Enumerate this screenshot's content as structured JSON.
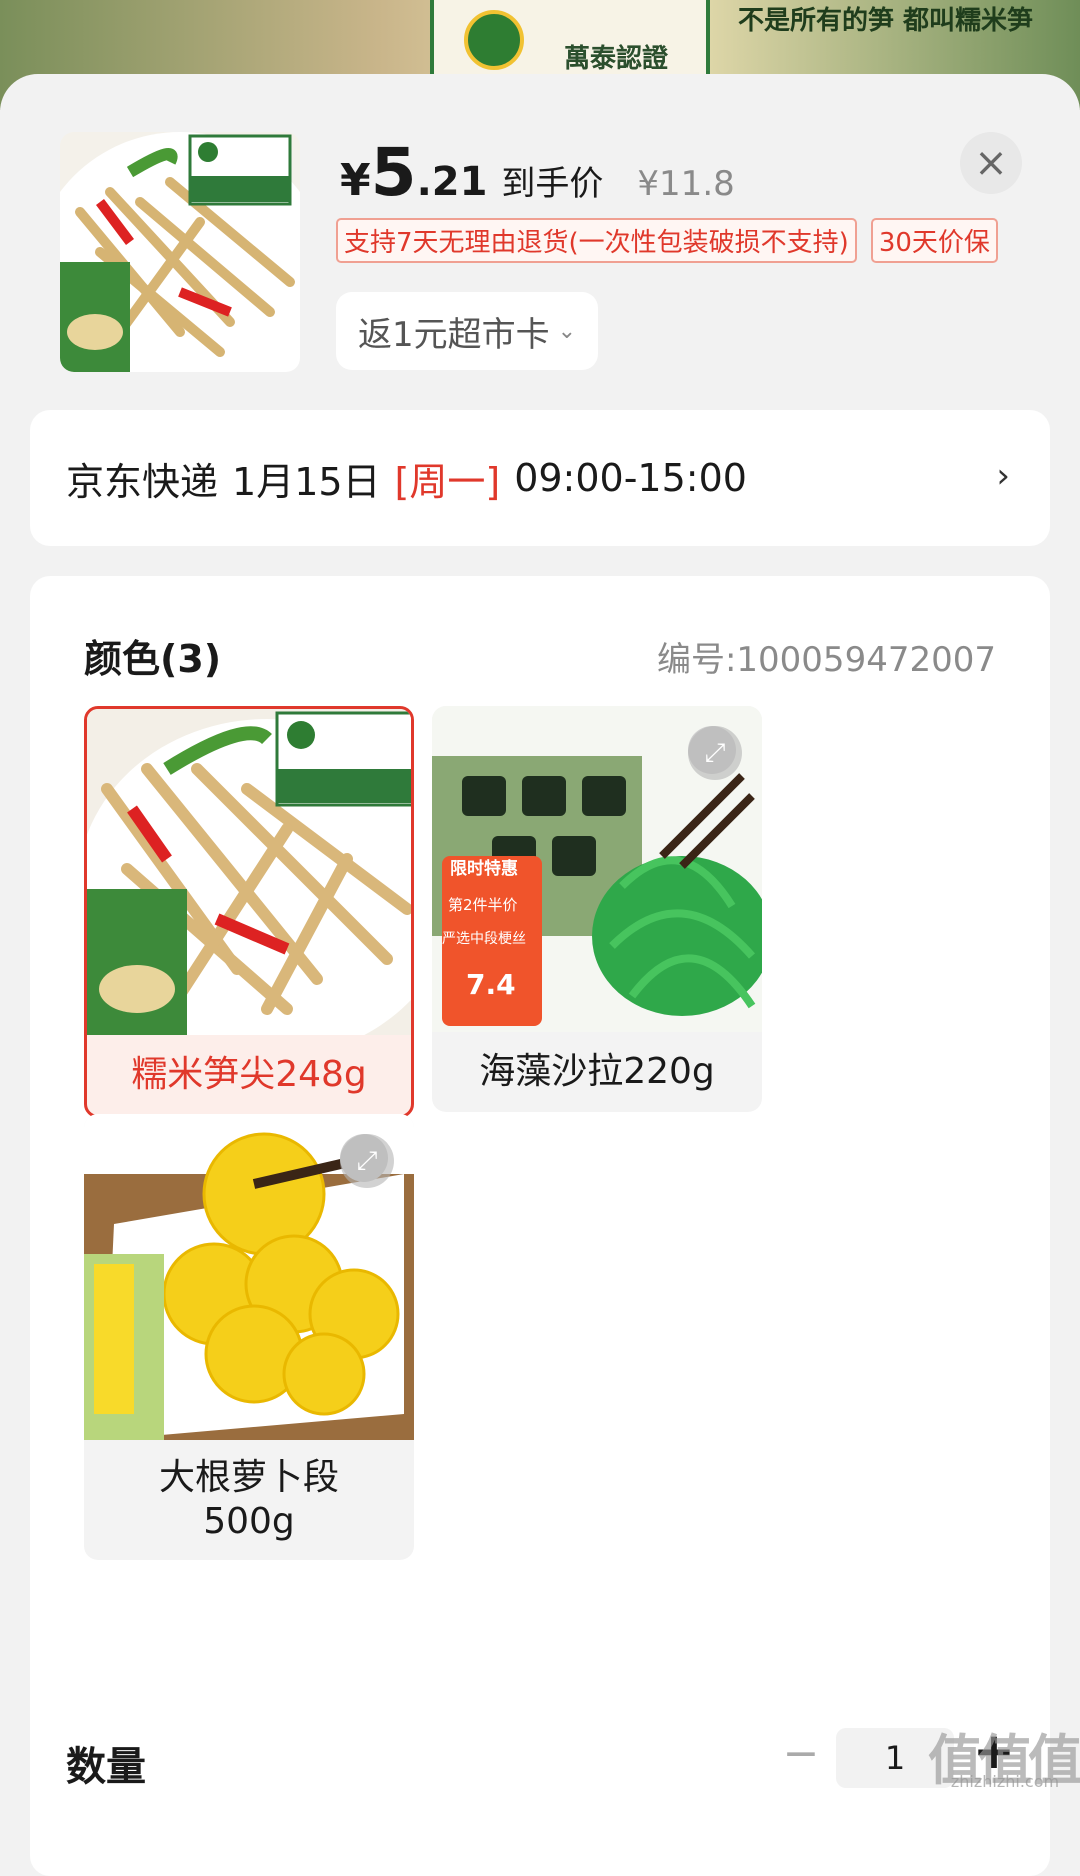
{
  "banner": {
    "cert_text": "萬泰認證",
    "slogan": "不是所有的笋 都叫糯米笋"
  },
  "summary": {
    "price_yen": "¥",
    "price_int": "5",
    "price_dec": ".21",
    "price_tag": "到手价",
    "original_price": "¥11.8",
    "tags": [
      "支持7天无理由退货(一次性包装破损不支持)",
      "30天价保"
    ],
    "card_chip_label": "返1元超市卡",
    "close_label": "×"
  },
  "delivery": {
    "carrier": "京东快递",
    "date": "1月15日",
    "weekday": "[周一]",
    "time": "09:00-15:00",
    "arrow": "›"
  },
  "options": {
    "title": "颜色(3)",
    "sku": "编号:100059472007",
    "variants": [
      {
        "label": "糯米笋尖248g",
        "selected": true
      },
      {
        "label": "海藻沙拉220g",
        "selected": false
      },
      {
        "label": "大根萝卜段\n500g",
        "selected": false
      }
    ],
    "seaweed_img_text": {
      "promo": "限时特惠",
      "half": "第2件半价",
      "pick": "严选中段梗丝",
      "price": "7.4"
    }
  },
  "quantity": {
    "label": "数量",
    "minus": "−",
    "value": "1",
    "plus": "+"
  },
  "watermark": {
    "text": "值值值",
    "sub": "zhizhizhi.com"
  },
  "colors": {
    "accent": "#e0382b",
    "text": "#1a1a1a",
    "muted": "#8a8a8a"
  }
}
